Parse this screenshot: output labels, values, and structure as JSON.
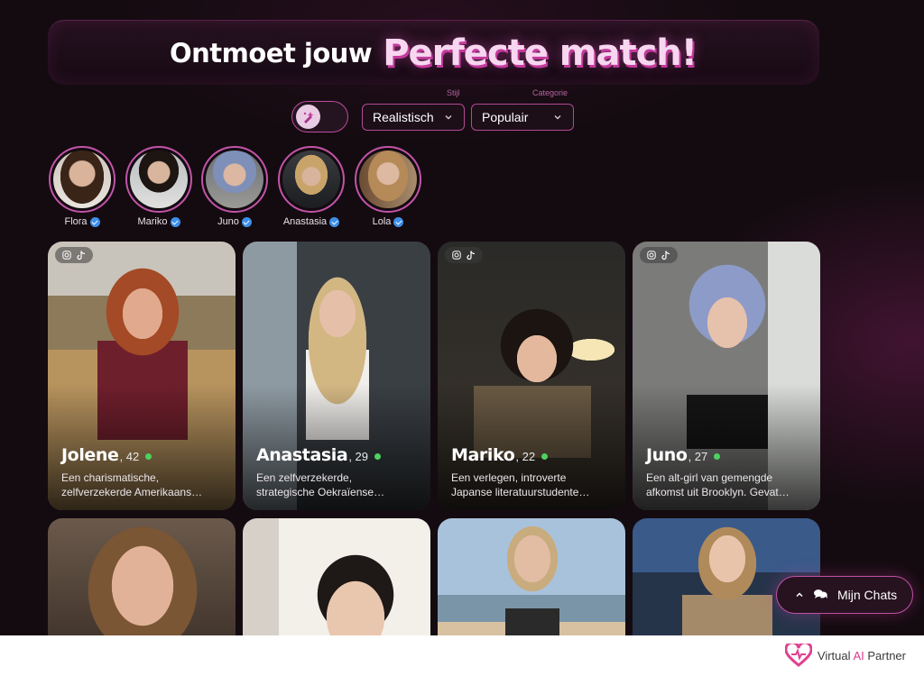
{
  "hero": {
    "lead": "Ontmoet jouw",
    "accent": "Perfecte match!"
  },
  "filters": {
    "style_caption": "Stijl",
    "style_value": "Realistisch",
    "category_caption": "Categorie",
    "category_value": "Populair",
    "toggle_icon": "sparkle-brush-icon"
  },
  "stories": [
    {
      "name": "Flora"
    },
    {
      "name": "Mariko"
    },
    {
      "name": "Juno"
    },
    {
      "name": "Anastasia"
    },
    {
      "name": "Lola"
    }
  ],
  "cards": [
    {
      "name": "Jolene",
      "age": ", 42",
      "desc1": "Een charismatische,",
      "desc2": "zelfverzekerde Amerikaans…"
    },
    {
      "name": "Anastasia",
      "age": ", 29",
      "desc1": "Een zelfverzekerde,",
      "desc2": "strategische Oekraïense…"
    },
    {
      "name": "Mariko",
      "age": ", 22",
      "desc1": "Een verlegen, introverte",
      "desc2": "Japanse literatuurstudente…"
    },
    {
      "name": "Juno",
      "age": ", 27",
      "desc1": "Een alt-girl van gemengde",
      "desc2": "afkomst uit Brooklyn. Gevat…"
    }
  ],
  "chats_button": "Mijn Chats",
  "footer": {
    "brand_pre": "Virtual",
    "brand_ai": "AI",
    "brand_post": "Partner"
  },
  "colors": {
    "accent": "#c14fa5",
    "background": "#140b10",
    "online": "#4cd25e",
    "verified": "#3d8fe8"
  }
}
